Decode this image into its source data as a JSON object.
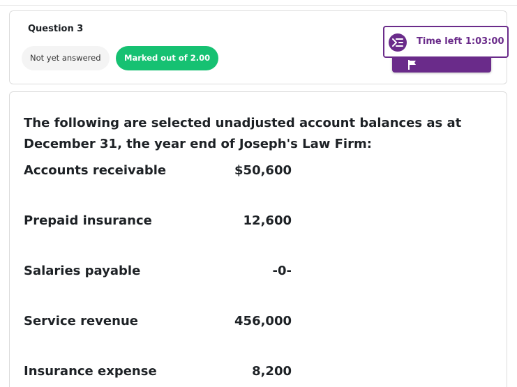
{
  "question": {
    "number_label": "Question 3",
    "state": "Not yet answered",
    "grade": "Marked out of 2.00"
  },
  "timer": {
    "label": "Time left 1:03:00",
    "icon": "timer-icon"
  },
  "flag": {
    "icon": "flag-icon"
  },
  "prompt": "The following are selected unadjusted account balances as at December 31, the year end of Joseph's Law Firm:",
  "accounts": [
    {
      "label": "Accounts receivable",
      "value": "$50,600"
    },
    {
      "label": "Prepaid insurance",
      "value": "12,600"
    },
    {
      "label": "Salaries payable",
      "value": "-0-"
    },
    {
      "label": "Service revenue",
      "value": "456,000"
    },
    {
      "label": "Insurance expense",
      "value": "8,200"
    }
  ],
  "colors": {
    "accent": "#6a2b8a",
    "success": "#16c172"
  }
}
